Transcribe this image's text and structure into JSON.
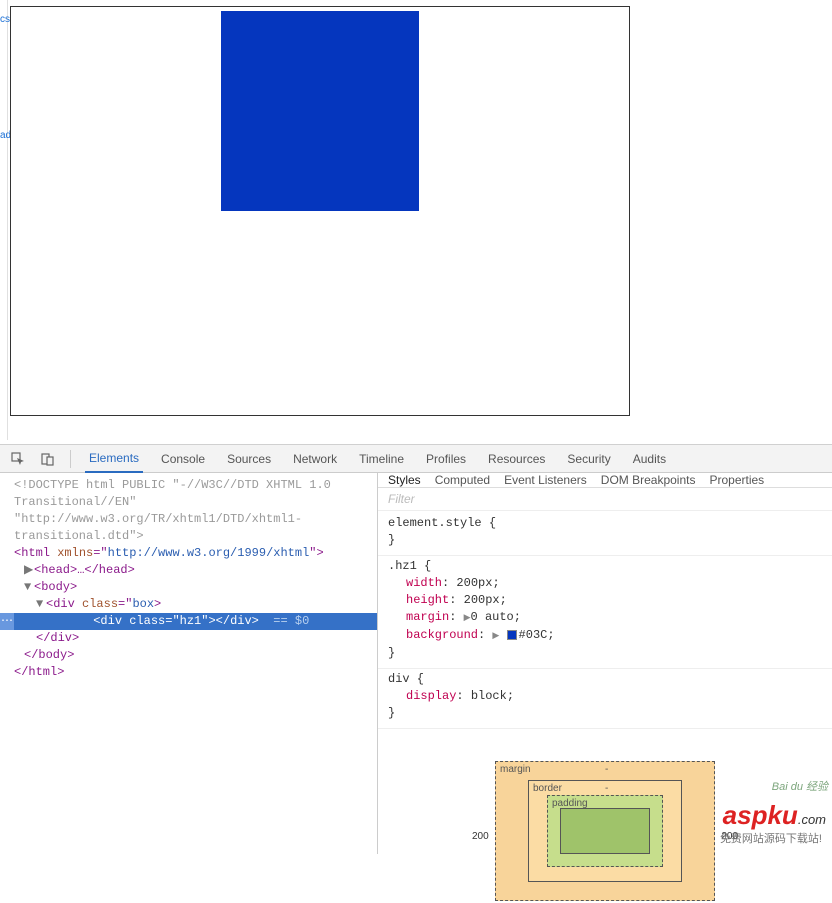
{
  "viewport": {},
  "devtools": {
    "tabs": [
      "Elements",
      "Console",
      "Sources",
      "Network",
      "Timeline",
      "Profiles",
      "Resources",
      "Security",
      "Audits"
    ],
    "active_tab": "Elements",
    "dom": {
      "doctype1": "<!DOCTYPE html PUBLIC \"-//W3C//DTD XHTML 1.0",
      "doctype2": "Transitional//EN\"",
      "doctype3": "\"http://www.w3.org/TR/xhtml1/DTD/xhtml1-",
      "doctype4": "transitional.dtd\">",
      "html_open_1": "<html ",
      "html_attr": "xmlns",
      "html_eq": "=\"",
      "html_val": "http://www.w3.org/1999/xhtml",
      "html_open_2": "\">",
      "head": "<head>…</head>",
      "body_open": "<body>",
      "box_open_1": "<div ",
      "box_attr": "class",
      "box_val": "box",
      "box_open_2": ">",
      "sel_open_1": "<div ",
      "sel_attr": "class",
      "sel_val": "hz1",
      "sel_close": "></div>",
      "sel_marker": "== $0",
      "box_close": "</div>",
      "body_close": "</body>",
      "html_close": "</html>"
    },
    "styles": {
      "subtabs": [
        "Styles",
        "Computed",
        "Event Listeners",
        "DOM Breakpoints",
        "Properties"
      ],
      "active_subtab": "Styles",
      "filter_placeholder": "Filter",
      "rules": [
        {
          "selector": "element.style {",
          "props": [],
          "close": "}"
        },
        {
          "selector": ".hz1 {",
          "props": [
            {
              "name": "width",
              "value": "200px"
            },
            {
              "name": "height",
              "value": "200px"
            },
            {
              "name": "margin",
              "value": "0 auto",
              "prefix": "▶"
            },
            {
              "name": "background",
              "value": "#03C",
              "prefix": "▶",
              "swatch": true
            }
          ],
          "close": "}"
        },
        {
          "selector": "div {",
          "props": [
            {
              "name": "display",
              "value": "block"
            }
          ],
          "close": "}"
        }
      ],
      "box_model": {
        "margin_label": "margin",
        "border_label": "border",
        "padding_label": "padding",
        "left": "200",
        "right": "200",
        "dash": "-"
      }
    }
  },
  "watermark": {
    "baidu": "Bai du 经验",
    "aspku": "aspku",
    "aspku_dot": ".com",
    "cn": "免费网站源码下载站!"
  }
}
